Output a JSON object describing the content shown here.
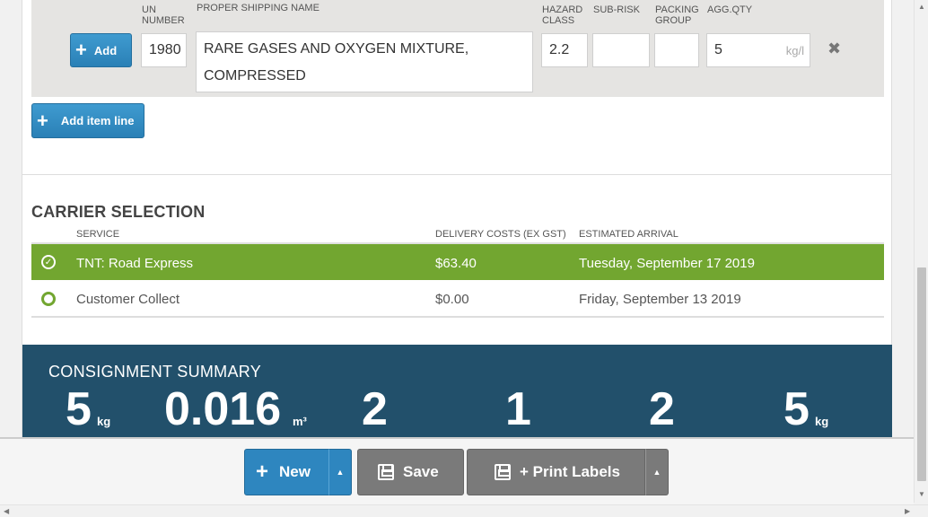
{
  "item_line": {
    "add_label": "Add",
    "headers": {
      "un_number": "UN NUMBER",
      "proper_shipping_name": "PROPER SHIPPING NAME",
      "hazard_class": "HAZARD CLASS",
      "sub_risk": "SUB-RISK",
      "packing_group": "PACKING GROUP",
      "agg_qty": "AGG.QTY"
    },
    "un_number": "1980",
    "proper_shipping_name": "RARE GASES AND OXYGEN MIXTURE, COMPRESSED",
    "hazard_class": "2.2",
    "sub_risk": "",
    "packing_group": "",
    "agg_qty": "5",
    "agg_qty_unit": "kg/l",
    "remove_icon": "close-icon"
  },
  "add_item_line_label": "Add item line",
  "carrier_selection": {
    "title": "CARRIER SELECTION",
    "headers": {
      "service": "SERVICE",
      "cost": "DELIVERY COSTS (EX GST)",
      "arrival": "ESTIMATED ARRIVAL"
    },
    "rows": [
      {
        "service": "TNT: Road Express",
        "cost": "$63.40",
        "arrival": "Tuesday, September 17 2019",
        "selected": true
      },
      {
        "service": "Customer Collect",
        "cost": "$0.00",
        "arrival": "Friday, September 13 2019",
        "selected": false
      }
    ],
    "selected_color": "#72a630"
  },
  "consignment_summary": {
    "title": "CONSIGNMENT SUMMARY",
    "stats": [
      {
        "value": "5",
        "unit": "kg"
      },
      {
        "value": "0.016",
        "unit": "m³"
      },
      {
        "value": "2",
        "unit": ""
      },
      {
        "value": "1",
        "unit": ""
      },
      {
        "value": "2",
        "unit": ""
      },
      {
        "value": "5",
        "unit": "kg"
      }
    ],
    "background_color": "#22506b"
  },
  "toolbar": {
    "new_label": "New",
    "save_label": "Save",
    "print_labels_label": "+ Print Labels"
  }
}
